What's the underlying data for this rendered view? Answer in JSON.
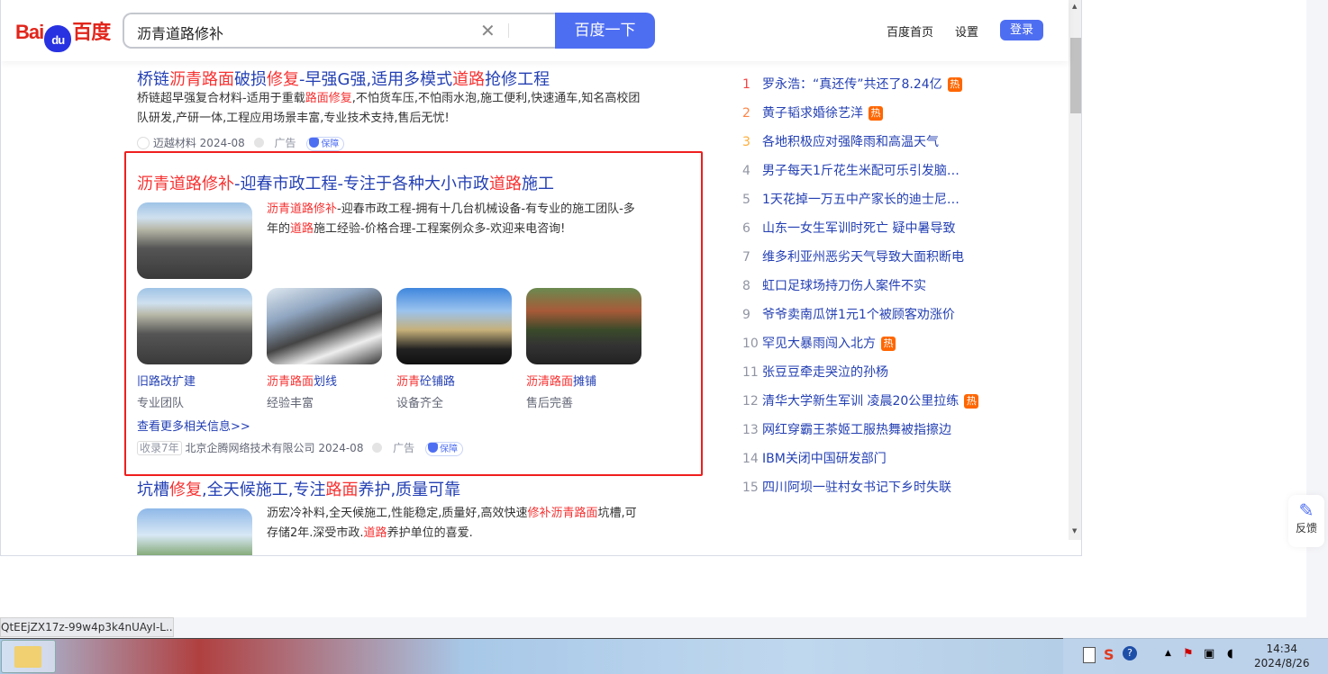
{
  "header": {
    "logo_text": "Bai百度",
    "logo_paw": "du",
    "search_value": "沥青道路修补",
    "search_button": "百度一下",
    "links": [
      "百度首页",
      "设置"
    ],
    "login": "登录"
  },
  "results": [
    {
      "title": [
        {
          "t": "桥链"
        },
        {
          "t": "沥青路面",
          "hl": true
        },
        {
          "t": "破损"
        },
        {
          "t": "修复",
          "hl": true
        },
        {
          "t": "-早强G强,适用多模式"
        },
        {
          "t": "道路",
          "hl": true
        },
        {
          "t": "抢修工程"
        }
      ],
      "desc": [
        {
          "t": "桥链超早强复合材料-适用于重载"
        },
        {
          "t": "路面修复",
          "hl": true
        },
        {
          "t": ",不怕货车压,不怕雨水泡,施工便利,快速通车,知名高校团队研发,产研一体,工程应用场景丰富,专业技术支持,售后无忧!"
        }
      ],
      "source": "迈越材料",
      "date": "2024-08",
      "ad": "广告",
      "badge": "保障"
    },
    {
      "title": [
        {
          "t": "沥青道路修补",
          "hl": true
        },
        {
          "t": "-迎春市政工程-专注于各种大小市政"
        },
        {
          "t": "道路",
          "hl": true
        },
        {
          "t": "施工"
        }
      ],
      "desc": [
        {
          "t": "沥青道路修补",
          "hl": true
        },
        {
          "t": "-迎春市政工程-拥有十几台机械设备-有专业的施工团队-多年的"
        },
        {
          "t": "道路",
          "hl": true
        },
        {
          "t": "施工经验-价格合理-工程案例众多-欢迎来电咨询!"
        }
      ],
      "tiles": [
        {
          "label": [
            {
              "t": "旧路改扩建"
            }
          ],
          "sub": "专业团队"
        },
        {
          "label": [
            {
              "t": "沥青路面",
              "hl": true
            },
            {
              "t": "划线"
            }
          ],
          "sub": "经验丰富"
        },
        {
          "label": [
            {
              "t": "沥青",
              "hl": true
            },
            {
              "t": "砼铺路"
            }
          ],
          "sub": "设备齐全"
        },
        {
          "label": [
            {
              "t": "沥清路面",
              "hl": true
            },
            {
              "t": "摊铺"
            }
          ],
          "sub": "售后完善"
        }
      ],
      "more": "查看更多相关信息>>",
      "record": "收录7年",
      "source": "北京企腾网络技术有限公司",
      "date": "2024-08",
      "ad": "广告",
      "badge": "保障"
    },
    {
      "title": [
        {
          "t": "坑槽"
        },
        {
          "t": "修复",
          "hl": true
        },
        {
          "t": ",全天候施工,专注"
        },
        {
          "t": "路面",
          "hl": true
        },
        {
          "t": "养护,质量可靠"
        }
      ],
      "desc": [
        {
          "t": "沥宏冷补料,全天候施工,性能稳定,质量好,高效快速"
        },
        {
          "t": "修补沥青路面",
          "hl": true
        },
        {
          "t": "坑槽,可存储2年.深受市政."
        },
        {
          "t": "道路",
          "hl": true
        },
        {
          "t": "养护单位的喜爱."
        }
      ]
    }
  ],
  "hot_list": [
    {
      "rank": "1",
      "text": "罗永浩：“真还传”共还了8.24亿",
      "hot": "热",
      "color": "#f54545"
    },
    {
      "rank": "2",
      "text": "黄子韬求婚徐艺洋",
      "hot": "热",
      "color": "#ff8547"
    },
    {
      "rank": "3",
      "text": "各地积极应对强降雨和高温天气",
      "color": "#ffac38"
    },
    {
      "rank": "4",
      "text": "男子每天1斤花生米配可乐引发脑…"
    },
    {
      "rank": "5",
      "text": "1天花掉一万五中产家长的迪士尼…"
    },
    {
      "rank": "6",
      "text": "山东一女生军训时死亡 疑中暑导致"
    },
    {
      "rank": "7",
      "text": "维多利亚州恶劣天气导致大面积断电"
    },
    {
      "rank": "8",
      "text": "虹口足球场持刀伤人案件不实"
    },
    {
      "rank": "9",
      "text": "爷爷卖南瓜饼1元1个被顾客劝涨价"
    },
    {
      "rank": "10",
      "text": "罕见大暴雨闯入北方",
      "hot": "热"
    },
    {
      "rank": "11",
      "text": "张豆豆牵走哭泣的孙杨"
    },
    {
      "rank": "12",
      "text": "清华大学新生军训 凌晨20公里拉练",
      "hot": "热"
    },
    {
      "rank": "13",
      "text": "网红穿霸王茶姬工服热舞被指擦边"
    },
    {
      "rank": "14",
      "text": "IBM关闭中国研发部门"
    },
    {
      "rank": "15",
      "text": "四川阿坝一驻村女书记下乡时失联"
    }
  ],
  "feedback": "反馈",
  "status_url": "QtEEjZX17z-99w4p3k4nUAyI-L...",
  "clock": {
    "time": "14:34",
    "date": "2024/8/26"
  }
}
